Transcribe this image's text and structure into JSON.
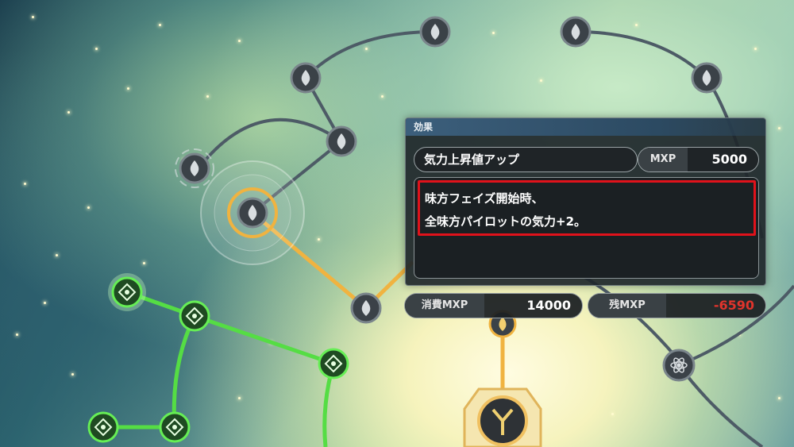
{
  "panel": {
    "title": "効果",
    "skill_name": "気力上昇値アップ",
    "mxp_label": "MXP",
    "mxp_value": "5000",
    "description": [
      "味方フェイズ開始時、",
      "全味方パイロットの気力+2。"
    ]
  },
  "stats": {
    "cost_label": "消費MXP",
    "cost_value": "14000",
    "remaining_label": "残MXP",
    "remaining_value": "-6590"
  },
  "colors": {
    "highlight_border": "#e0121b",
    "remaining_negative": "#e0342c",
    "path_active": "#f0b340",
    "path_learned": "#55dd44",
    "path_locked": "#4d5b66"
  },
  "nodes": [
    {
      "id": "node-a",
      "icon": "flame-icon",
      "state": "locked"
    },
    {
      "id": "node-b",
      "icon": "flame-icon",
      "state": "locked"
    },
    {
      "id": "node-c",
      "icon": "flame-icon",
      "state": "locked"
    },
    {
      "id": "node-d",
      "icon": "flame-icon",
      "state": "locked"
    },
    {
      "id": "node-e",
      "icon": "flame-icon",
      "state": "locked"
    },
    {
      "id": "node-f",
      "icon": "flame-icon",
      "state": "locked"
    },
    {
      "id": "node-selected",
      "icon": "flame-icon",
      "state": "selected"
    },
    {
      "id": "node-g",
      "icon": "flame-icon",
      "state": "locked"
    },
    {
      "id": "node-atom",
      "icon": "atom-icon",
      "state": "locked"
    },
    {
      "id": "node-learned-1",
      "icon": "diamond-star-icon",
      "state": "learned"
    },
    {
      "id": "node-learned-2",
      "icon": "diamond-star-icon",
      "state": "learned"
    },
    {
      "id": "node-learned-3",
      "icon": "diamond-star-icon",
      "state": "learned"
    },
    {
      "id": "node-learned-4",
      "icon": "diamond-star-icon",
      "state": "learned"
    },
    {
      "id": "node-learned-5",
      "icon": "diamond-star-icon",
      "state": "learned"
    },
    {
      "id": "node-root",
      "icon": "emblem-icon",
      "state": "root"
    }
  ]
}
